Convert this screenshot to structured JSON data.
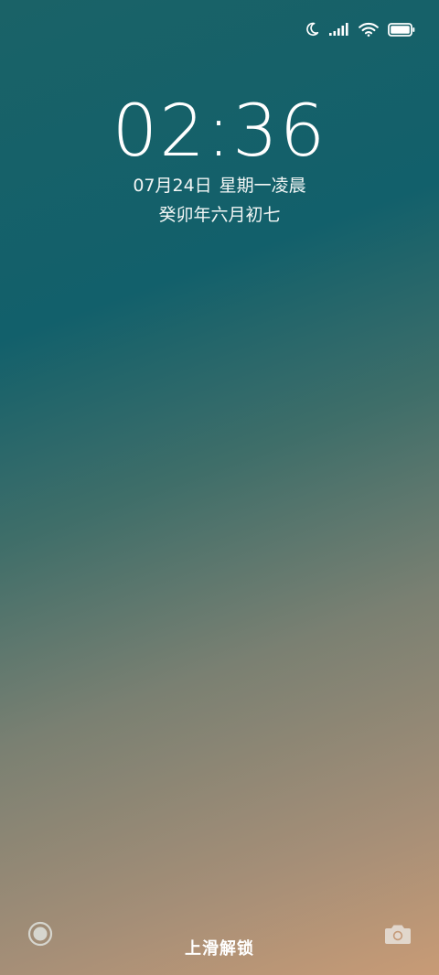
{
  "status_bar": {
    "icons": [
      "moon-icon",
      "signal-icon",
      "wifi-icon",
      "battery-icon"
    ],
    "battery_level": 1.0
  },
  "clock": {
    "time": "02:36",
    "date": "07月24日",
    "weekday_period": "星期一凌晨",
    "lunar_date": "癸卯年六月初七"
  },
  "bottom": {
    "unlock_hint": "上滑解锁",
    "left_icon": "assistant-dot-icon",
    "right_icon": "camera-icon"
  },
  "colors": {
    "gradient_top": "#12606b",
    "gradient_bottom": "#c89b76",
    "text": "#ffffff"
  }
}
